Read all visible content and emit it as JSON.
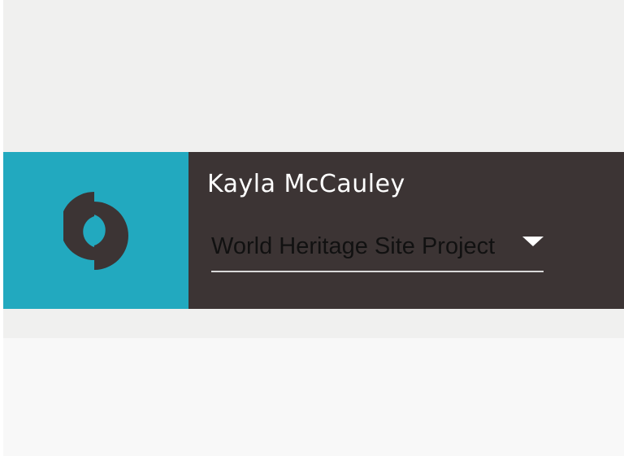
{
  "colors": {
    "logo_panel_bg": "#22a9bf",
    "info_panel_bg": "#3c3434",
    "logo_mark": "#3c3434",
    "name_text": "#ffffff",
    "project_text": "#111111",
    "underline": "#d8d8d8"
  },
  "header": {
    "logo_icon": "split-circle-logo-icon",
    "user_name": "Kayla McCauley",
    "project_select": {
      "value": "World Heritage Site Project",
      "icon": "caret-down-icon"
    }
  }
}
